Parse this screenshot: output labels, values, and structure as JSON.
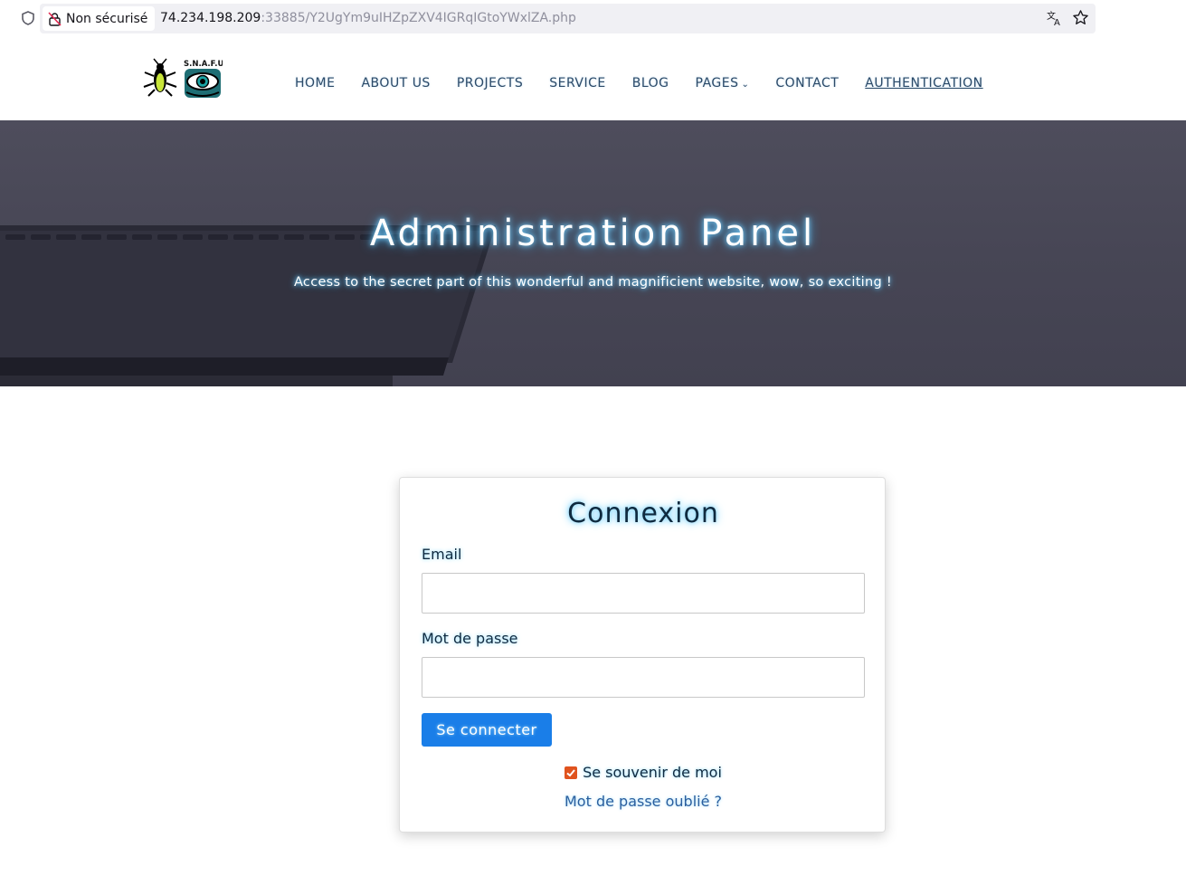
{
  "browser": {
    "security_label": "Non sécurisé",
    "url_host": "74.234.198.209",
    "url_rest": ":33885/Y2UgYm9uIHZpZXV4IGRqIGtoYWxlZA.php"
  },
  "header": {
    "logo_text": "S.N.A.F.U",
    "nav": [
      {
        "label": "HOME"
      },
      {
        "label": "ABOUT US"
      },
      {
        "label": "PROJECTS"
      },
      {
        "label": "SERVICE"
      },
      {
        "label": "BLOG"
      },
      {
        "label": "PAGES",
        "has_dropdown": true
      },
      {
        "label": "CONTACT"
      },
      {
        "label": "AUTHENTICATION",
        "active": true
      }
    ]
  },
  "hero": {
    "title": "Administration Panel",
    "subtitle": "Access to the secret part of this wonderful and magnificient website, wow, so exciting !"
  },
  "login": {
    "title": "Connexion",
    "email_label": "Email",
    "email_value": "",
    "password_label": "Mot de passe",
    "password_value": "",
    "submit_label": "Se connecter",
    "remember_label": "Se souvenir de moi",
    "remember_checked": true,
    "forgot_label": "Mot de passe oublié ?"
  },
  "colors": {
    "accent_blue": "#1a7ee8",
    "checkbox_orange": "#e0531e",
    "nav_text": "#2c4a68"
  }
}
